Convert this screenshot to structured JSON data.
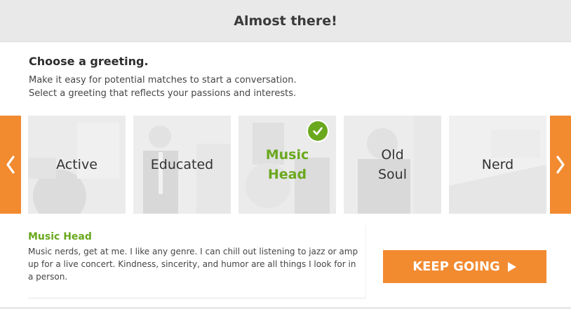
{
  "header": {
    "title": "Almost there!"
  },
  "intro": {
    "title": "Choose a greeting.",
    "line1": "Make it easy for potential matches to start a conversation.",
    "line2": "Select a greeting that reflects your passions and interests."
  },
  "carousel": {
    "prev_icon": "chevron-left-icon",
    "next_icon": "chevron-right-icon",
    "cards": [
      {
        "label": "Active",
        "selected": false
      },
      {
        "label": "Educated",
        "selected": false
      },
      {
        "label": "Music\nHead",
        "selected": true
      },
      {
        "label": "Old\nSoul",
        "selected": false
      },
      {
        "label": "Nerd",
        "selected": false
      }
    ]
  },
  "selected_greeting": {
    "title": "Music Head",
    "text": "Music nerds, get at me. I like any genre. I can chill out listening to jazz or amp up for a live concert. Kindness, sincerity, and humor are all things I look for in a person."
  },
  "actions": {
    "keep_going_label": "KEEP GOING"
  },
  "colors": {
    "accent": "#f28a30",
    "selected": "#6aa81e",
    "header_bg": "#e9e9e9"
  }
}
